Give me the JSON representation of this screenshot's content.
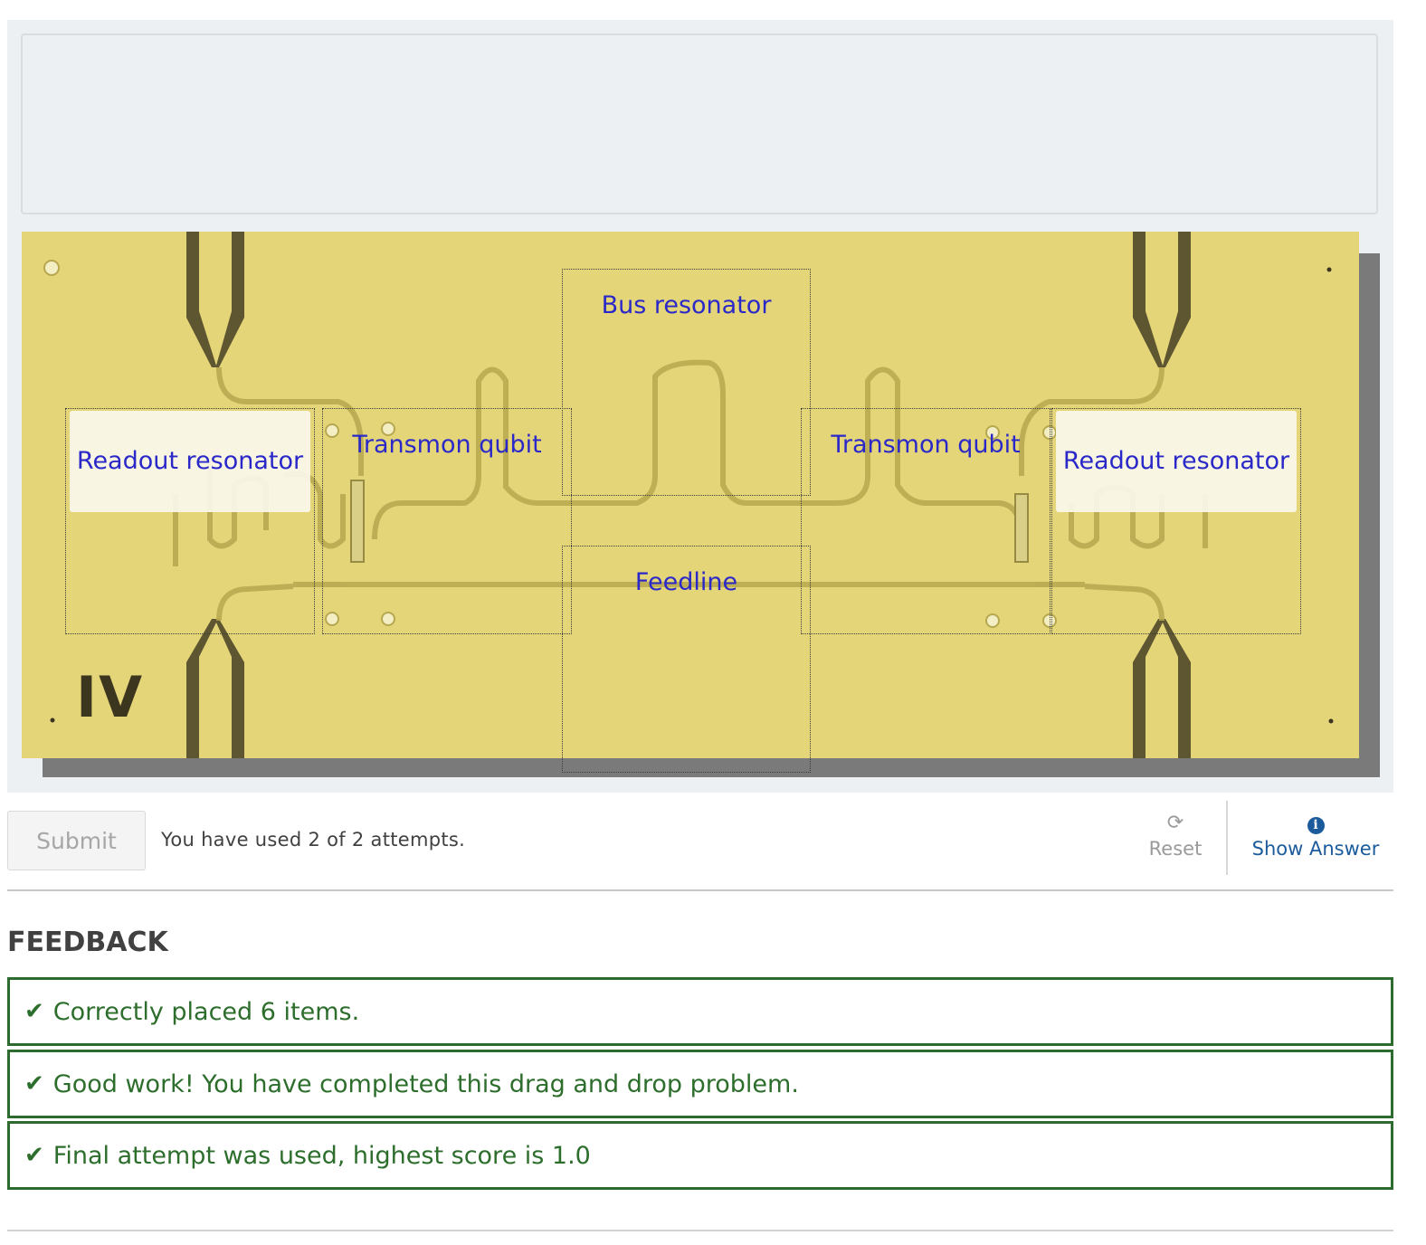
{
  "image_alt": "",
  "zones": {
    "readout_left": "Readout resonator",
    "transmon_left": "Transmon qubit",
    "bus": "Bus resonator",
    "feedline": "Feedline",
    "transmon_right": "Transmon qubit",
    "readout_right": "Readout resonator"
  },
  "chip_marking": "IV",
  "actions": {
    "submit_label": "Submit",
    "attempts_text": "You have used 2 of 2 attempts.",
    "reset_label": "Reset",
    "show_answer_label": "Show Answer"
  },
  "feedback": {
    "title": "FEEDBACK",
    "messages": [
      "Correctly placed 6 items.",
      "Good work! You have completed this drag and drop problem.",
      "Final attempt was used, highest score is 1.0"
    ]
  },
  "colors": {
    "chip": "#e5d579",
    "label": "#2a28c8",
    "success": "#2e6b2e",
    "link": "#1b5b9c"
  }
}
